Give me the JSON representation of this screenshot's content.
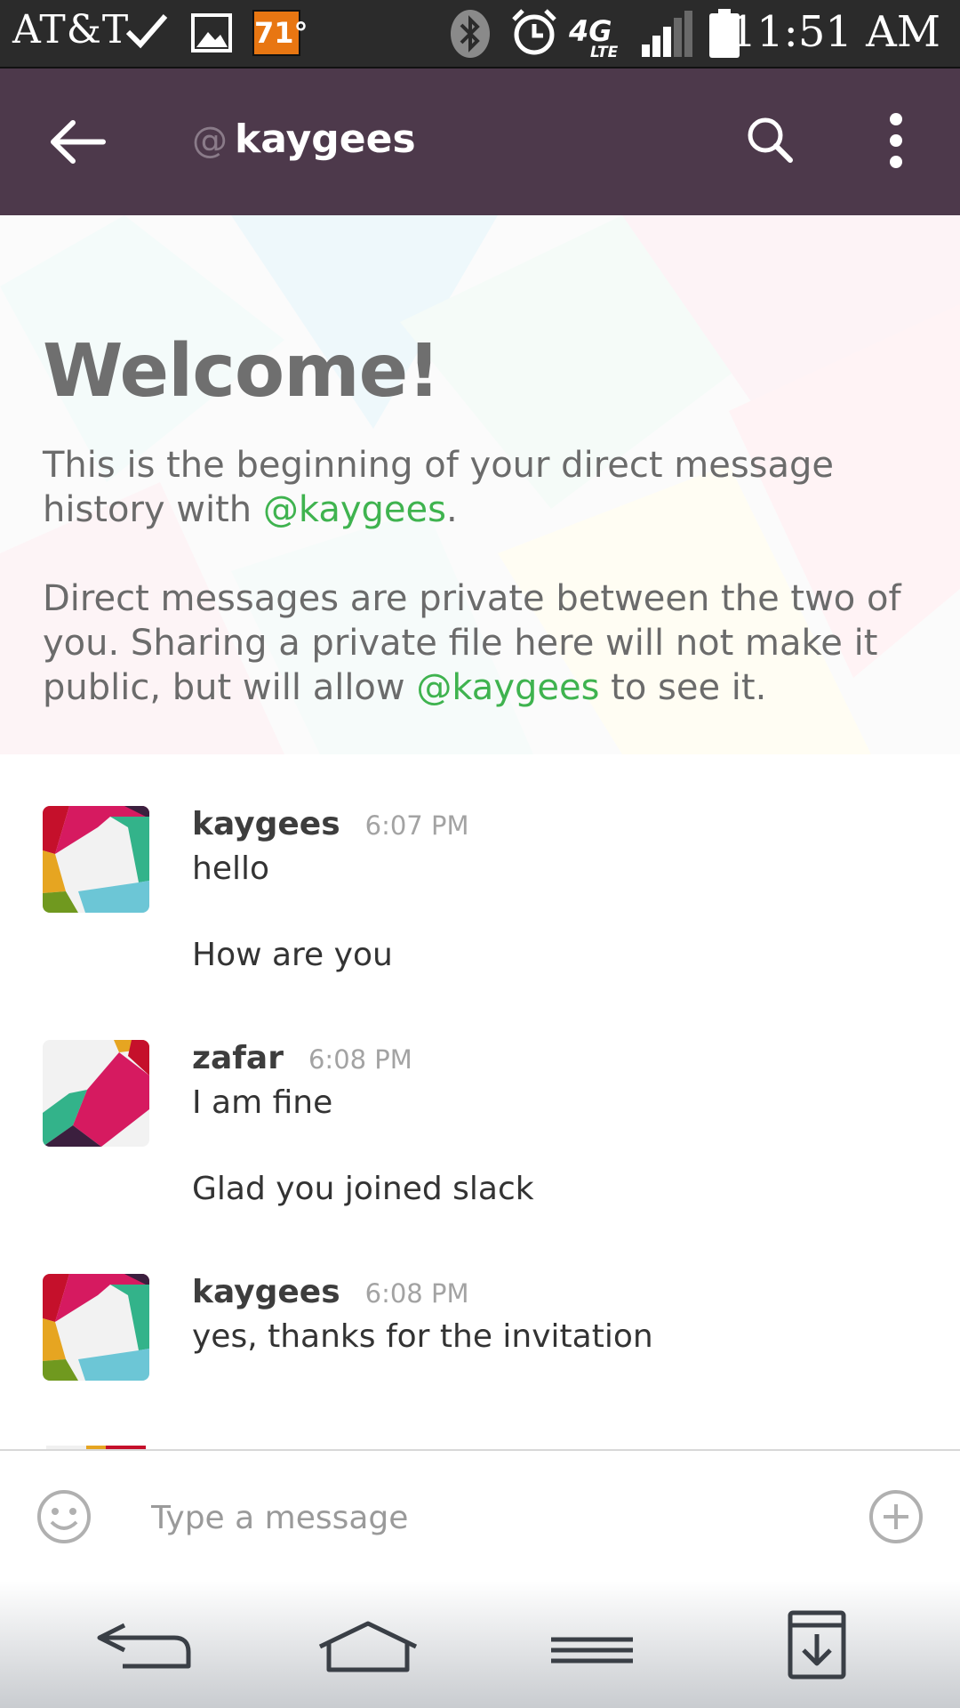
{
  "status_bar": {
    "carrier": "AT&T",
    "temperature": "71°",
    "network": "4G LTE",
    "time": "11:51 AM",
    "icons": [
      "check-icon",
      "image-icon",
      "bluetooth-icon",
      "alarm-icon",
      "4g-lte-icon",
      "signal-icon",
      "battery-icon"
    ]
  },
  "header": {
    "at_symbol": "@",
    "title": "kaygees",
    "icons": [
      "back-arrow-icon",
      "search-icon",
      "more-vertical-icon"
    ]
  },
  "welcome": {
    "title": "Welcome!",
    "p1_text": "This is the beginning of your direct message history with ",
    "p1_mention": "@kaygees",
    "p1_end": ".",
    "p2_text": "Direct messages are private between the two of you. Sharing a private file here will not make it public, but will allow ",
    "p2_mention": "@kaygees",
    "p2_end": " to see it."
  },
  "messages": [
    {
      "user": "kaygees",
      "time": "6:07 PM",
      "lines": [
        "hello",
        "How are you"
      ]
    },
    {
      "user": "zafar",
      "time": "6:08 PM",
      "lines": [
        "I am fine",
        "Glad you joined slack"
      ]
    },
    {
      "user": "kaygees",
      "time": "6:08 PM",
      "lines": [
        "yes, thanks for the invitation"
      ]
    }
  ],
  "composer": {
    "placeholder": "Type a message",
    "icons": [
      "emoji-icon",
      "add-attachment-icon"
    ]
  },
  "nav_bar": {
    "icons": [
      "nav-back-icon",
      "nav-home-icon",
      "nav-menu-icon",
      "nav-download-icon"
    ]
  },
  "colors": {
    "app_bar": "#4d394b",
    "mention": "#3fb34f",
    "status_bar": "#2b2b2b",
    "temperature_badge": "#e87612"
  }
}
